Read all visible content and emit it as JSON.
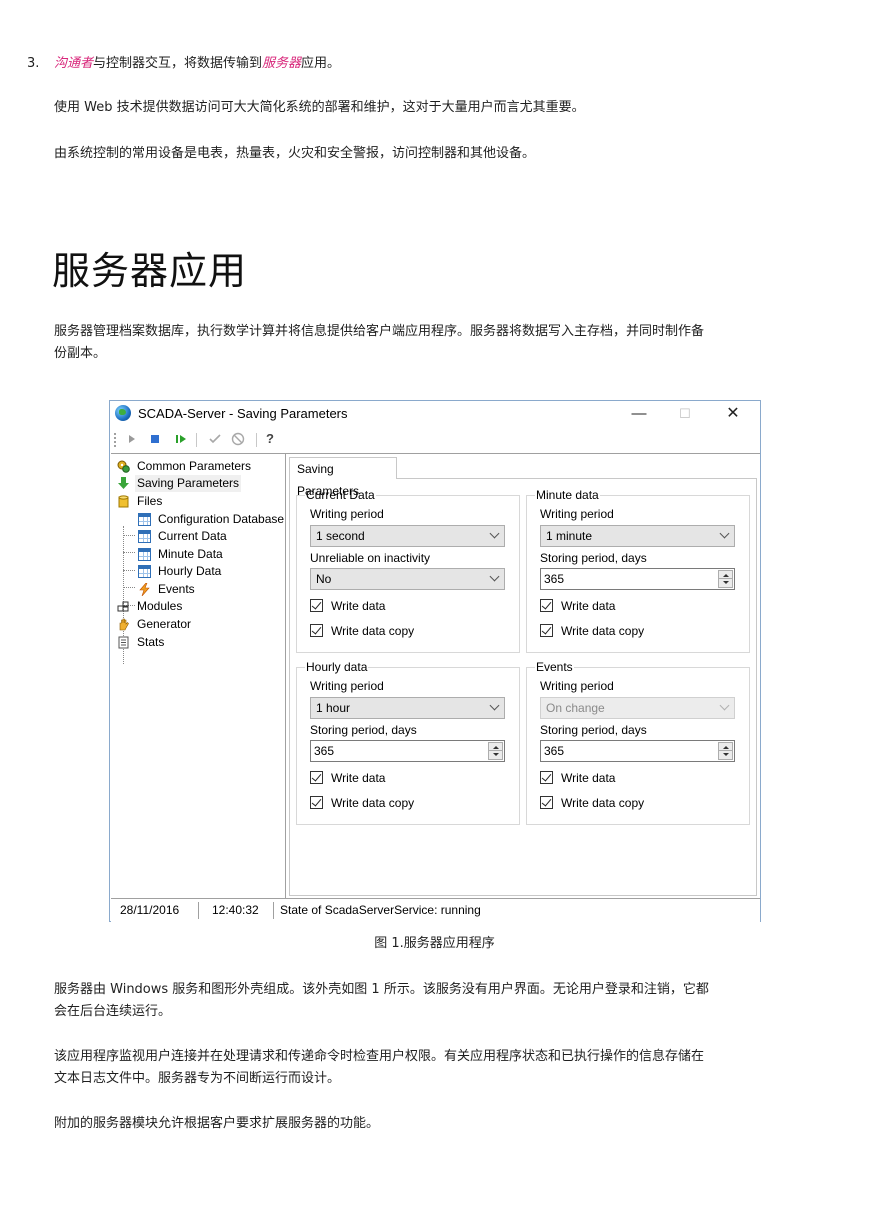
{
  "intro": {
    "item_number": "3.",
    "item_link1": "沟通者",
    "item_text1": "与控制器交互，将数据传输到",
    "item_link2": "服务器",
    "item_text2": "应用。",
    "para1": "使用 Web 技术提供数据访问可大大简化系统的部署和维护，这对于大量用户而言尤其重要。",
    "para2": "由系统控制的常用设备是电表，热量表，火灾和安全警报，访问控制器和其他设备。"
  },
  "section": {
    "title": "服务器应用",
    "para1_line1": "服务器管理档案数据库，执行数学计算并将信息提供给客户端应用程序。服务器将数据写入主存档，并同时制作备",
    "para1_line2": "份副本。"
  },
  "window": {
    "title": "SCADA-Server - Saving Parameters",
    "controls": {
      "minimize": "—",
      "maximize": "☐",
      "close": "✕"
    },
    "toolbar_help": "?",
    "tree": [
      {
        "label": "Common Parameters",
        "icon": "gears-icon"
      },
      {
        "label": "Saving Parameters",
        "icon": "down-arrow-icon"
      },
      {
        "label": "Files",
        "icon": "database-icon"
      },
      {
        "label": "Configuration Database",
        "icon": "table-icon"
      },
      {
        "label": "Current Data",
        "icon": "table-icon"
      },
      {
        "label": "Minute Data",
        "icon": "table-icon"
      },
      {
        "label": "Hourly Data",
        "icon": "table-icon"
      },
      {
        "label": "Events",
        "icon": "lightning-icon"
      },
      {
        "label": "Modules",
        "icon": "modules-icon"
      },
      {
        "label": "Generator",
        "icon": "hand-icon"
      },
      {
        "label": "Stats",
        "icon": "document-icon"
      }
    ],
    "tab_label": "Saving Parameters",
    "groups": {
      "current": {
        "title": "Current Data",
        "label1": "Writing period",
        "value1": "1 second",
        "label2": "Unreliable on inactivity",
        "value2": "No",
        "check1": "Write data",
        "check2": "Write data copy"
      },
      "minute": {
        "title": "Minute data",
        "label1": "Writing period",
        "value1": "1 minute",
        "label2": "Storing period, days",
        "value2": "365",
        "check1": "Write data",
        "check2": "Write data copy"
      },
      "hourly": {
        "title": "Hourly data",
        "label1": "Writing period",
        "value1": "1 hour",
        "label2": "Storing period, days",
        "value2": "365",
        "check1": "Write data",
        "check2": "Write data copy"
      },
      "events": {
        "title": "Events",
        "label1": "Writing period",
        "value1": "On change",
        "label2": "Storing period, days",
        "value2": "365",
        "check1": "Write data",
        "check2": "Write data copy"
      }
    },
    "status": {
      "date": "28/11/2016",
      "time": "12:40:32",
      "state": "State of ScadaServerService: running"
    }
  },
  "figure_caption": "图 1.服务器应用程序",
  "after": {
    "p1_line1": "服务器由 Windows 服务和图形外壳组成。该外壳如图 1 所示。该服务没有用户界面。无论用户登录和注销，它都",
    "p1_line2": "会在后台连续运行。",
    "p2_line1": "该应用程序监视用户连接并在处理请求和传递命令时检查用户权限。有关应用程序状态和已执行操作的信息存储在",
    "p2_line2": "文本日志文件中。服务器专为不间断运行而设计。",
    "p3": "附加的服务器模块允许根据客户要求扩展服务器的功能。"
  }
}
